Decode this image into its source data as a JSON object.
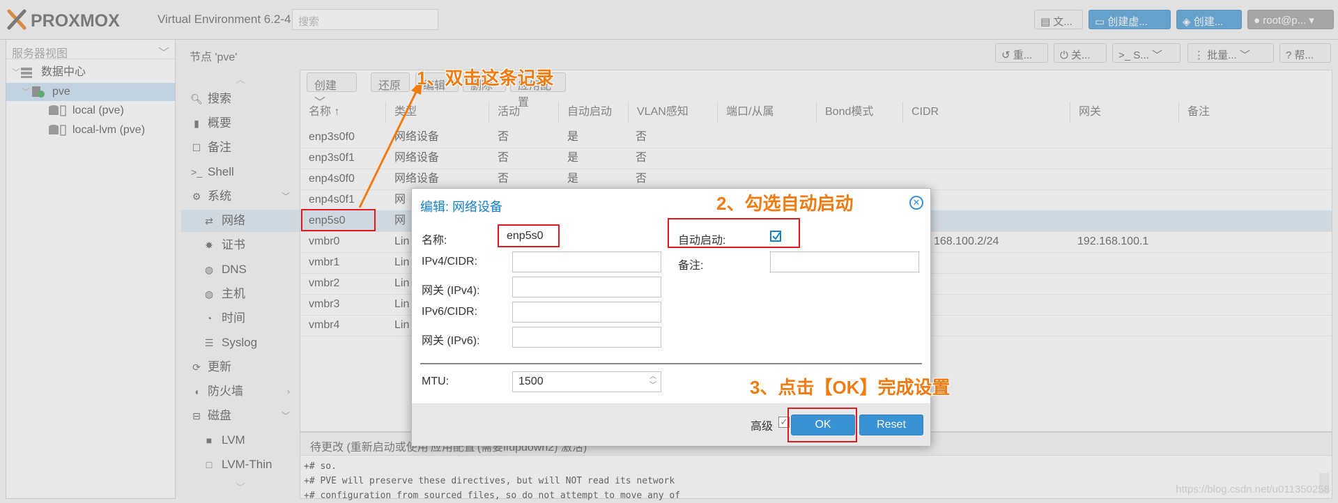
{
  "topbar": {
    "brand": "PROXMOX",
    "version": "Virtual Environment 6.2-4",
    "search_placeholder": "搜索",
    "buttons": [
      {
        "label": "文..."
      },
      {
        "label": "创建虚..."
      },
      {
        "label": "创建..."
      },
      {
        "label": "root@p..."
      }
    ]
  },
  "tree": {
    "view": "服务器视图",
    "items": [
      {
        "label": "数据中心"
      },
      {
        "label": "pve"
      },
      {
        "label": "local (pve)"
      },
      {
        "label": "local-lvm (pve)"
      }
    ]
  },
  "node": {
    "title": "节点 'pve'",
    "actions": [
      "重...",
      "关...",
      "S...",
      "批量...",
      "帮..."
    ]
  },
  "nav": [
    {
      "label": "搜索",
      "icon": "search-icon"
    },
    {
      "label": "概要",
      "icon": "book-icon"
    },
    {
      "label": "备注",
      "icon": "note-icon"
    },
    {
      "label": "Shell",
      "icon": "terminal-icon"
    },
    {
      "label": "系统",
      "icon": "gears-icon"
    },
    {
      "label": "网络",
      "icon": "exchange-icon"
    },
    {
      "label": "证书",
      "icon": "certificate-icon"
    },
    {
      "label": "DNS",
      "icon": "globe-icon"
    },
    {
      "label": "主机",
      "icon": "globe-icon"
    },
    {
      "label": "时间",
      "icon": "clock-icon"
    },
    {
      "label": "Syslog",
      "icon": "list-icon"
    },
    {
      "label": "更新",
      "icon": "refresh-icon"
    },
    {
      "label": "防火墙",
      "icon": "shield-icon"
    },
    {
      "label": "磁盘",
      "icon": "hdd-icon"
    },
    {
      "label": "LVM",
      "icon": "square-icon"
    },
    {
      "label": "LVM-Thin",
      "icon": "square-outline-icon"
    }
  ],
  "grid": {
    "toolbar": {
      "create": "创建",
      "revert": "还原",
      "edit": "编辑",
      "remove": "删除",
      "apply": "应用配置"
    },
    "columns": [
      "名称 ↑",
      "类型",
      "活动",
      "自动启动",
      "VLAN感知",
      "端口/从属",
      "Bond模式",
      "CIDR",
      "网关",
      "备注"
    ],
    "rows": [
      {
        "name": "enp3s0f0",
        "type": "网络设备",
        "active": "否",
        "autostart": "是",
        "vlan": "否",
        "cidr": "",
        "gw": ""
      },
      {
        "name": "enp3s0f1",
        "type": "网络设备",
        "active": "否",
        "autostart": "是",
        "vlan": "否",
        "cidr": "",
        "gw": ""
      },
      {
        "name": "enp4s0f0",
        "type": "网络设备",
        "active": "否",
        "autostart": "是",
        "vlan": "否",
        "cidr": "",
        "gw": ""
      },
      {
        "name": "enp4s0f1",
        "type": "网",
        "active": "",
        "autostart": "",
        "vlan": "",
        "cidr": "",
        "gw": ""
      },
      {
        "name": "enp5s0",
        "type": "网",
        "active": "",
        "autostart": "",
        "vlan": "",
        "cidr": "",
        "gw": ""
      },
      {
        "name": "vmbr0",
        "type": "Lin",
        "active": "",
        "autostart": "",
        "vlan": "",
        "cidr": "168.100.2/24",
        "gw": "192.168.100.1"
      },
      {
        "name": "vmbr1",
        "type": "Lin",
        "active": "",
        "autostart": "",
        "vlan": "",
        "cidr": "",
        "gw": ""
      },
      {
        "name": "vmbr2",
        "type": "Lin",
        "active": "",
        "autostart": "",
        "vlan": "",
        "cidr": "",
        "gw": ""
      },
      {
        "name": "vmbr3",
        "type": "Lin",
        "active": "",
        "autostart": "",
        "vlan": "",
        "cidr": "",
        "gw": ""
      },
      {
        "name": "vmbr4",
        "type": "Lin",
        "active": "",
        "autostart": "",
        "vlan": "",
        "cidr": "",
        "gw": ""
      }
    ]
  },
  "pending": {
    "title": "待更改 (重新启动或使用'应用配置'(需要ifupdown2) 激活)",
    "lines": [
      "+# so.",
      "+# PVE will preserve these directives, but will NOT read its network",
      "+# configuration from sourced files, so do not attempt to move any of"
    ]
  },
  "dialog": {
    "title": "编辑: 网络设备",
    "name_label": "名称:",
    "name_value": "enp5s0",
    "ipv4_label": "IPv4/CIDR:",
    "gw4_label": "网关 (IPv4):",
    "ipv6_label": "IPv6/CIDR:",
    "gw6_label": "网关 (IPv6):",
    "autostart_label": "自动启动:",
    "autostart_checked": true,
    "comment_label": "备注:",
    "mtu_label": "MTU:",
    "mtu_value": "1500",
    "advanced_label": "高级",
    "ok_label": "OK",
    "reset_label": "Reset"
  },
  "annotations": {
    "step1": "1、双击这条记录",
    "step2": "2、勾选自动启动",
    "step3": "3、点击【OK】完成设置"
  },
  "watermark": "https://blog.csdn.net/u011350258",
  "colors": {
    "accent": "#3892d4",
    "annotation": "#f07b10",
    "highlight": "#e0191f"
  }
}
